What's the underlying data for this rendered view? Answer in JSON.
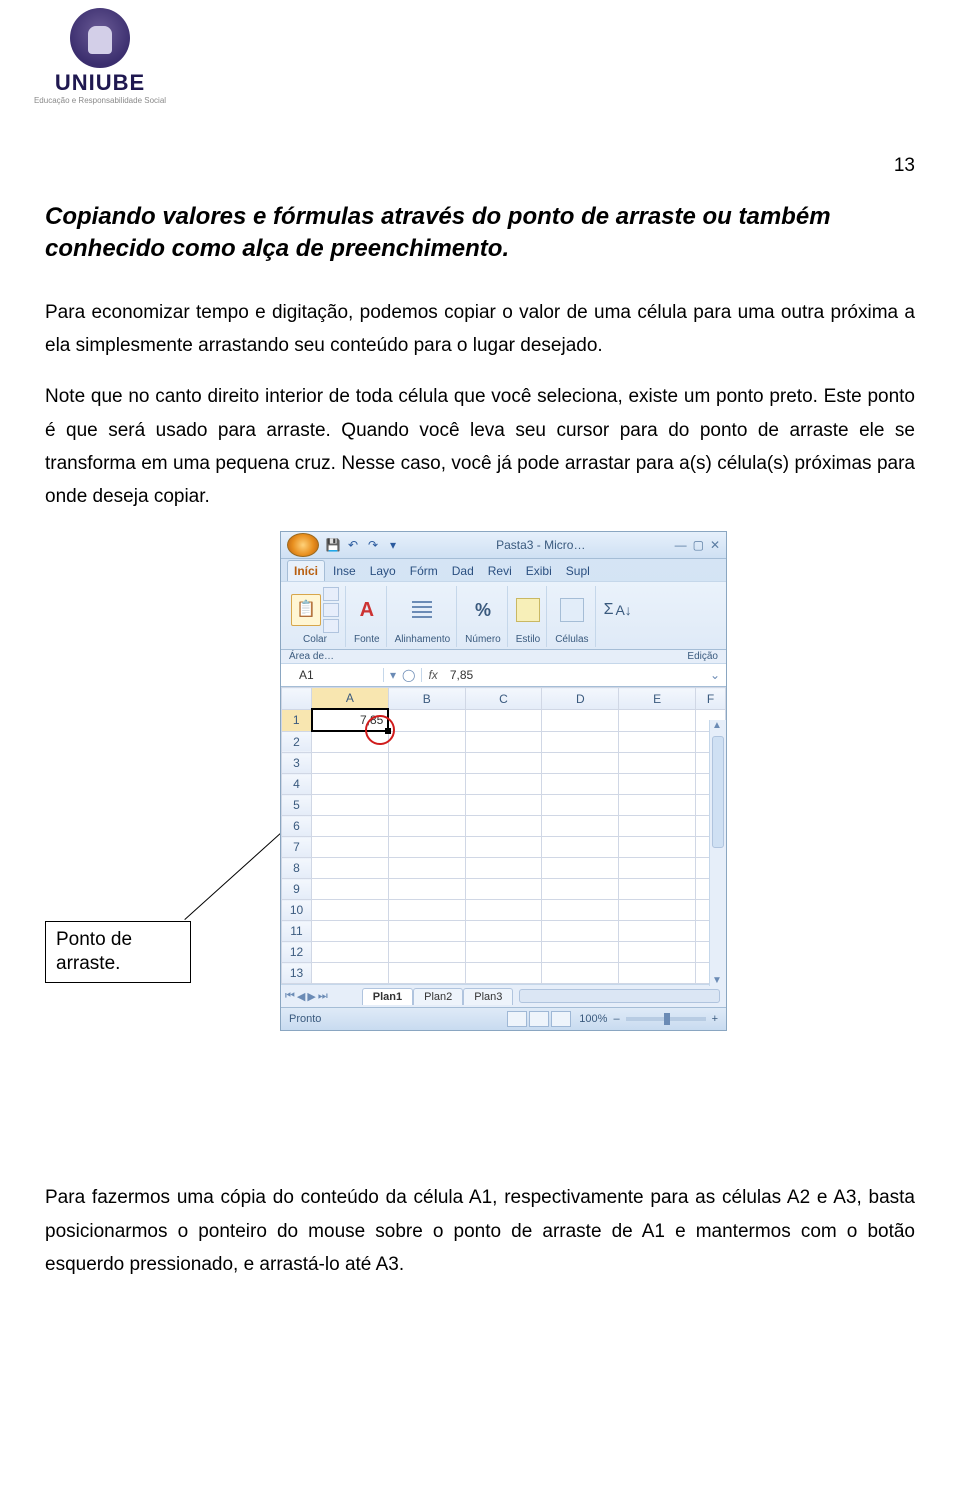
{
  "logo": {
    "word": "UNIUBE",
    "sub": "Educação e Responsabilidade Social"
  },
  "page_number": "13",
  "section_title": "Copiando valores e fórmulas através do ponto de arraste ou também conhecido como alça de preenchimento.",
  "paragraph1": "Para economizar tempo e digitação, podemos copiar o valor de uma célula para uma outra próxima a ela simplesmente arrastando seu conteúdo para o lugar desejado.",
  "paragraph2": "Note que no canto direito interior de toda célula que você seleciona, existe um ponto preto. Este ponto é que será usado para arraste.  Quando você leva seu cursor para do ponto de arraste ele se transforma em uma pequena cruz. Nesse caso, você já pode arrastar para a(s) célula(s) próximas para onde deseja copiar.",
  "callout": "Ponto de arraste.",
  "paragraph3": "Para fazermos uma cópia do conteúdo da célula A1, respectivamente para as células A2 e A3, basta posicionarmos o ponteiro do mouse sobre o ponto de arraste de A1 e mantermos com o botão esquerdo pressionado, e arrastá-lo até A3.",
  "excel": {
    "title": "Pasta3 - Micro…",
    "tabs": [
      "Iníci",
      "Inse",
      "Layo",
      "Fórm",
      "Dad",
      "Revi",
      "Exibi",
      "Supl"
    ],
    "groups": {
      "paste": "Colar",
      "font": "Fonte",
      "align": "Alinhamento",
      "number": "Número",
      "style": "Estilo",
      "cells": "Células"
    },
    "subbar_left": "Área de…",
    "subbar_right": "Edição",
    "namebox": "A1",
    "fx_label": "fx",
    "fx_value": "7,85",
    "columns": [
      "A",
      "B",
      "C",
      "D",
      "E",
      "F"
    ],
    "rows": [
      "1",
      "2",
      "3",
      "4",
      "5",
      "6",
      "7",
      "8",
      "9",
      "10",
      "11",
      "12",
      "13"
    ],
    "cell_a1": "7,85",
    "sheet_tabs": [
      "Plan1",
      "Plan2",
      "Plan3"
    ],
    "status": "Pronto",
    "zoom": "100%"
  }
}
